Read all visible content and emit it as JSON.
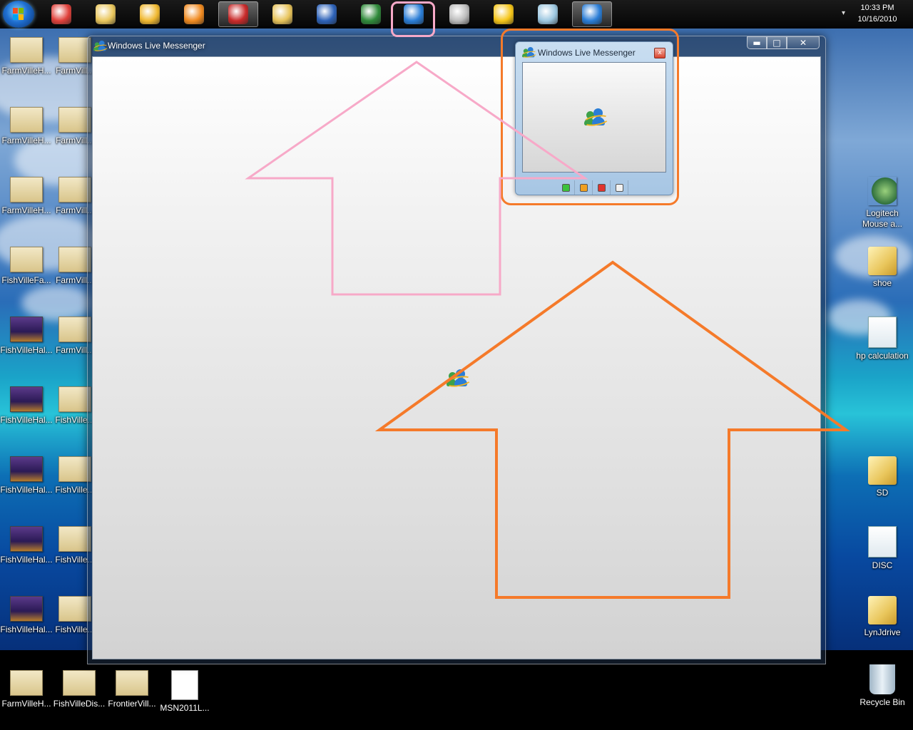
{
  "taskbar": {
    "clock_time": "10:33 PM",
    "clock_date": "10/16/2010",
    "tray_arrow": "▾",
    "apps": [
      {
        "name": "chrome-icon",
        "color": "#e0403a"
      },
      {
        "name": "explorer-icon",
        "color": "#e9c65c"
      },
      {
        "name": "outlook-icon",
        "color": "#f0b830"
      },
      {
        "name": "media-player-icon",
        "color": "#f08a20"
      },
      {
        "name": "snipping-tool-icon",
        "color": "#c92a2a"
      },
      {
        "name": "paint-icon",
        "color": "#e7c35a"
      },
      {
        "name": "word-icon",
        "color": "#2d62b8"
      },
      {
        "name": "excel-icon",
        "color": "#2f8a3a"
      },
      {
        "name": "messenger-icon",
        "color": "#2a7dd6"
      },
      {
        "name": "speedometer-icon",
        "color": "#bbbbbb"
      },
      {
        "name": "bird-icon",
        "color": "#f5c518"
      },
      {
        "name": "notepad-icon",
        "color": "#9cc7e0"
      },
      {
        "name": "messenger-active-icon",
        "color": "#2a7dd6"
      }
    ]
  },
  "desktop": {
    "left_col1": [
      "FarmVilleH...",
      "FarmVilleH...",
      "FarmVilleH...",
      "FishVilleFa...",
      "FishVilleHal...",
      "FishVilleHal...",
      "FishVilleHal...",
      "FishVilleHal...",
      "FishVilleHal..."
    ],
    "left_col2": [
      "FarmVill...",
      "FarmVill...",
      "FarmVill...",
      "FarmVill...",
      "FarmVill...",
      "FishVille...",
      "FishVille...",
      "FishVille...",
      "FishVille..."
    ],
    "bottom_row": [
      "FarmVilleH...",
      "FishVilleDis...",
      "FrontierVill...",
      "MSN2011L..."
    ],
    "right_col": [
      {
        "label": "Logitech Mouse a...",
        "kind": "mouse"
      },
      {
        "label": "shoe",
        "kind": "folder"
      },
      {
        "label": "hp calculation",
        "kind": "xls"
      },
      {
        "label": "SD",
        "kind": "folder"
      },
      {
        "label": "DISC",
        "kind": "xls"
      },
      {
        "label": "LynJdrive",
        "kind": "folder"
      }
    ],
    "recycle_bin": "Recycle Bin"
  },
  "main_window": {
    "title": "Windows Live Messenger",
    "minimize": "▬",
    "maximize": "□",
    "close": "✕"
  },
  "small_window": {
    "title": "Windows Live Messenger",
    "close": "x",
    "statuses": [
      {
        "name": "status-available",
        "color": "#3cc23c"
      },
      {
        "name": "status-away",
        "color": "#f0a020"
      },
      {
        "name": "status-busy",
        "color": "#e0342e"
      },
      {
        "name": "status-offline",
        "color": "#f2f2f2"
      }
    ]
  },
  "annotations": {
    "pink_color": "#f7a9c8",
    "orange_color": "#f57a2a"
  }
}
